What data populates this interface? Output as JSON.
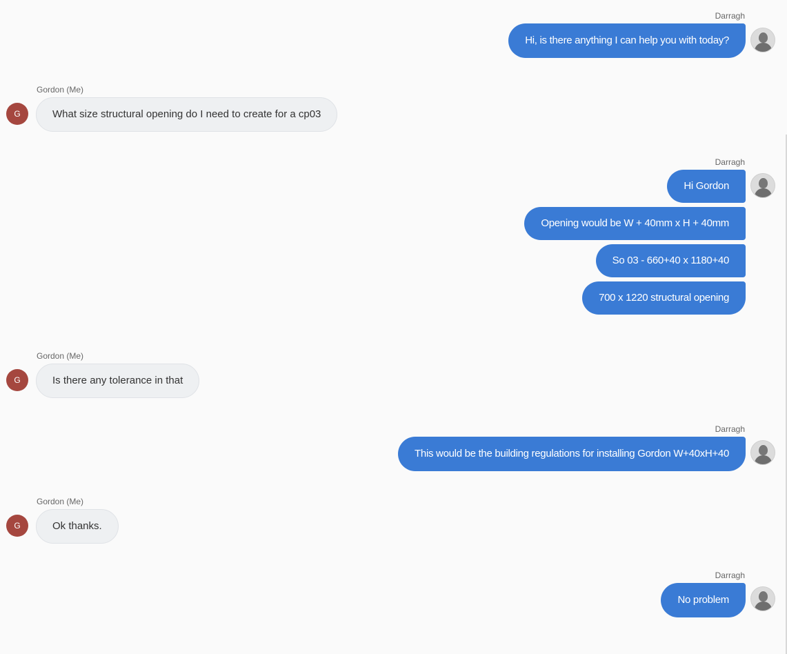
{
  "agent": {
    "name": "Darragh",
    "avatar_icon": "user-silhouette-icon"
  },
  "me": {
    "name": "Gordon (Me)",
    "initial": "G",
    "avatar_color": "#a5473f"
  },
  "colors": {
    "agent_bubble": "#3a7bd5",
    "me_bubble": "#eef0f2"
  },
  "messages": [
    {
      "sender": "Darragh",
      "side": "agent",
      "lines": [
        "Hi, is there anything I can help you with today?"
      ]
    },
    {
      "sender": "Gordon (Me)",
      "side": "me",
      "lines": [
        "What size structural opening do I need to create for a cp03"
      ]
    },
    {
      "sender": "Darragh",
      "side": "agent",
      "lines": [
        "Hi Gordon",
        "Opening would be W + 40mm x H + 40mm",
        "So 03 - 660+40 x 1180+40",
        "700 x 1220 structural opening"
      ]
    },
    {
      "sender": "Gordon (Me)",
      "side": "me",
      "lines": [
        "Is there any tolerance in that"
      ]
    },
    {
      "sender": "Darragh",
      "side": "agent",
      "lines": [
        "This would be the building regulations for installing Gordon W+40xH+40"
      ]
    },
    {
      "sender": "Gordon (Me)",
      "side": "me",
      "lines": [
        "Ok thanks."
      ]
    },
    {
      "sender": "Darragh",
      "side": "agent",
      "lines": [
        "No problem"
      ]
    }
  ]
}
